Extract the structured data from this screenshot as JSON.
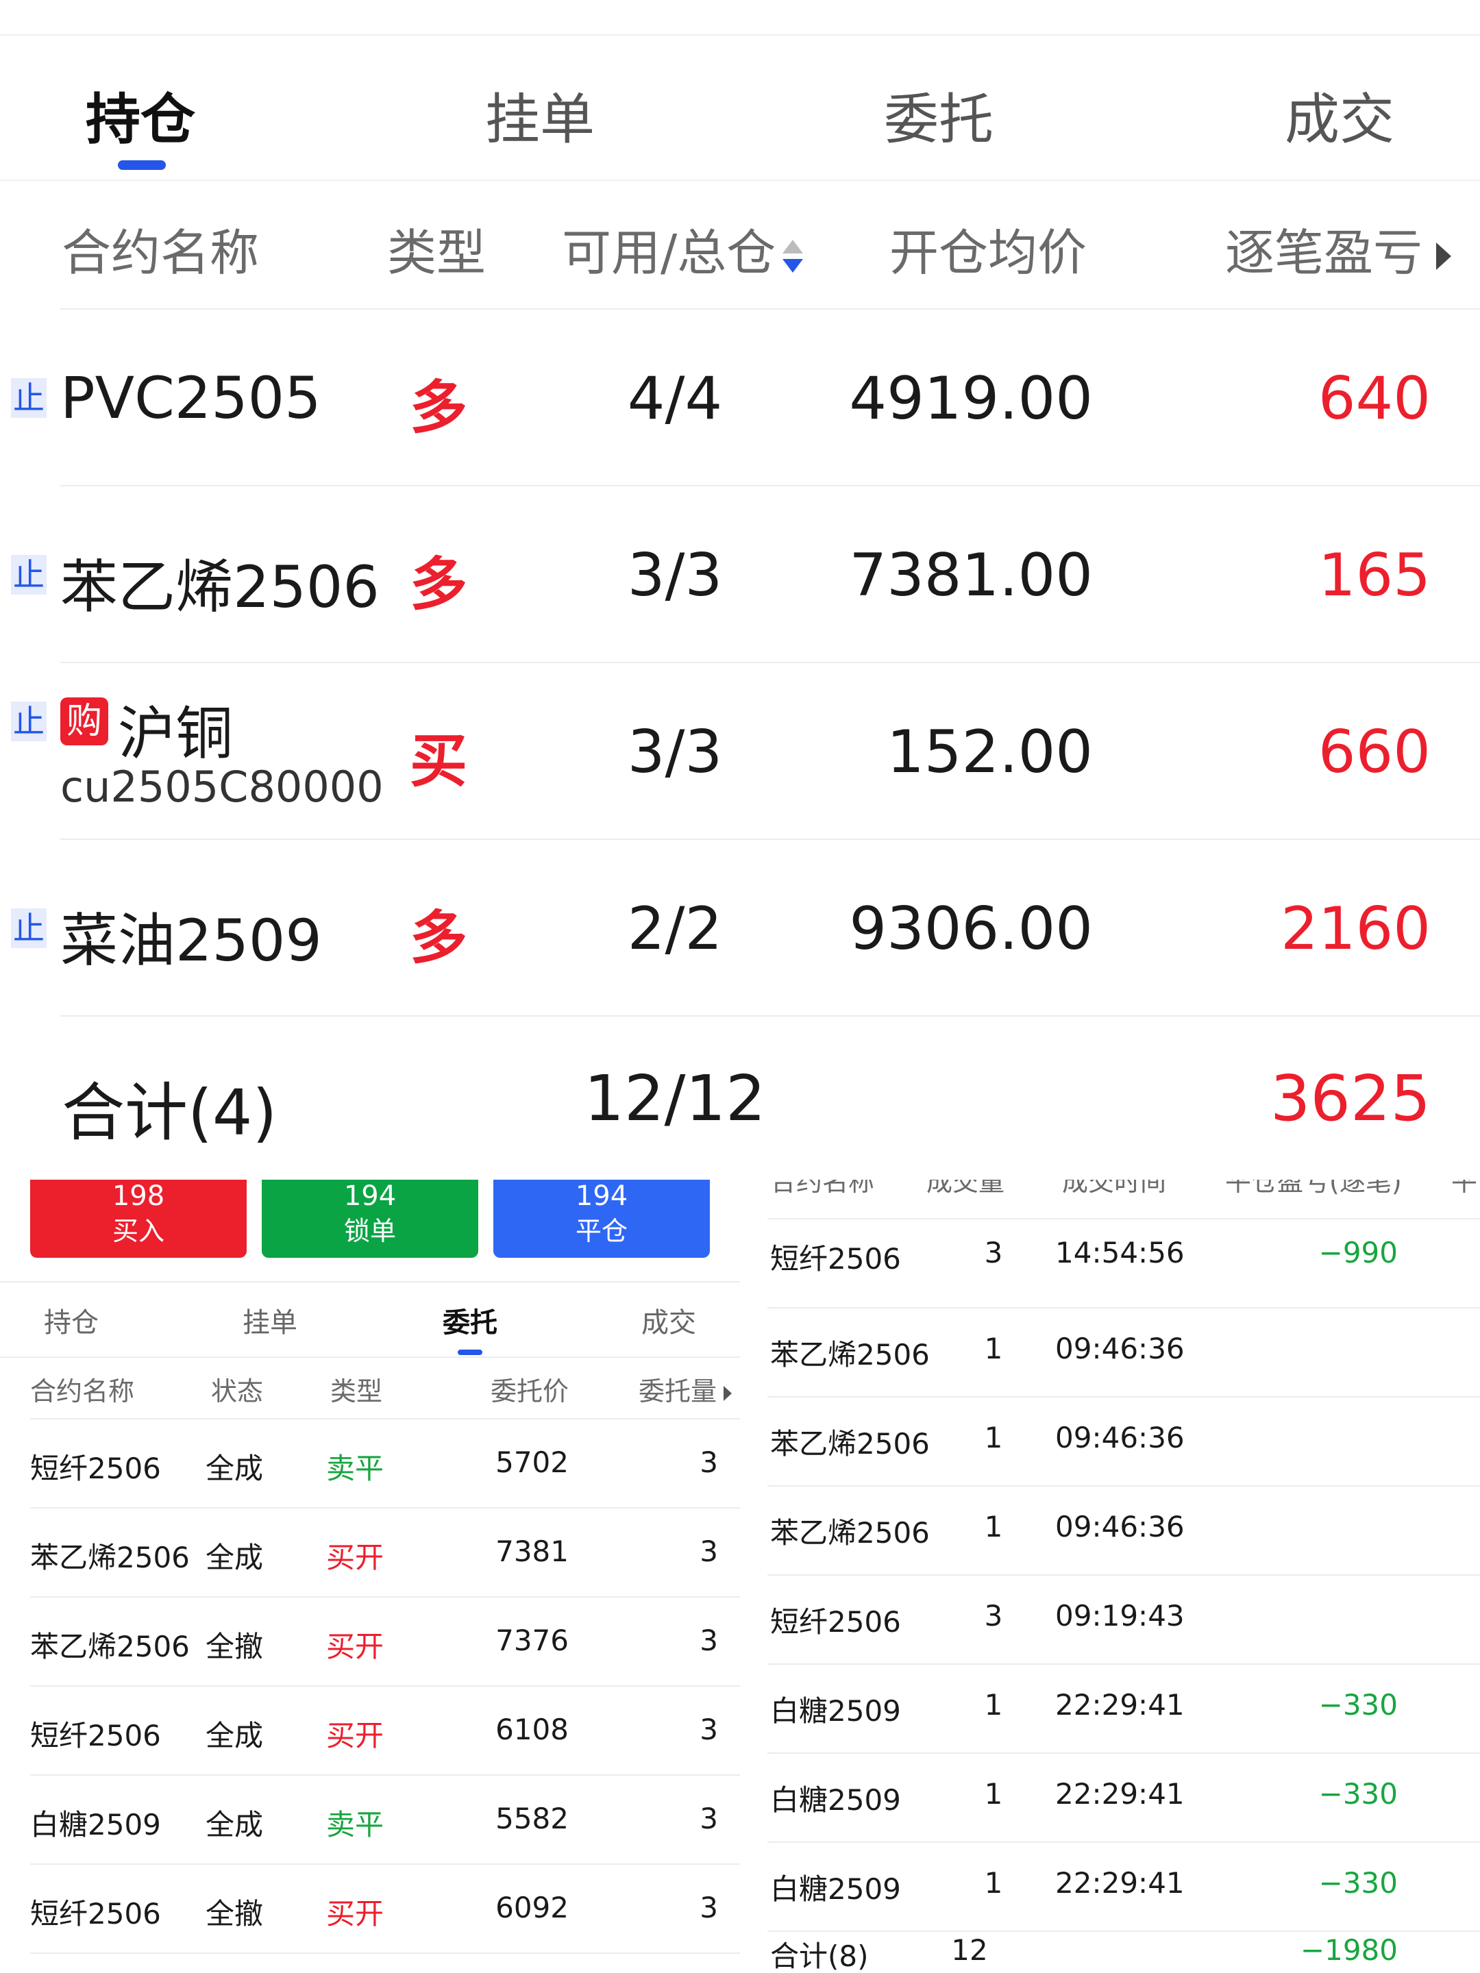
{
  "colors": {
    "red": "#ec1f2d",
    "green": "#18a63f",
    "blue": "#2456e8"
  },
  "top": {
    "tabs": [
      "持仓",
      "挂单",
      "委托",
      "成交"
    ],
    "active_tab": "持仓",
    "headers": {
      "name": "合约名称",
      "type": "类型",
      "qty": "可用/总仓",
      "price": "开仓均价",
      "pnl": "逐笔盈亏"
    },
    "stop_badge": "止",
    "buy_badge": "购",
    "rows": [
      {
        "name": "PVC2505",
        "sub": "",
        "type": "多",
        "qty": "4/4",
        "price": "4919.00",
        "pnl": "640"
      },
      {
        "name": "苯乙烯2506",
        "sub": "",
        "type": "多",
        "qty": "3/3",
        "price": "7381.00",
        "pnl": "165"
      },
      {
        "name": "沪铜",
        "sub": "cu2505C80000",
        "type": "买",
        "qty": "3/3",
        "price": "152.00",
        "pnl": "660"
      },
      {
        "name": "菜油2509",
        "sub": "",
        "type": "多",
        "qty": "2/2",
        "price": "9306.00",
        "pnl": "2160"
      }
    ],
    "total": {
      "label": "合计(4)",
      "qty": "12/12",
      "pnl": "3625"
    }
  },
  "orders": {
    "buttons": [
      {
        "num": "198",
        "label": "买入",
        "color": "#ec1f2d"
      },
      {
        "num": "194",
        "label": "锁单",
        "color": "#0aa444"
      },
      {
        "num": "194",
        "label": "平仓",
        "color": "#2f67f5"
      }
    ],
    "tabs": [
      "持仓",
      "挂单",
      "委托",
      "成交"
    ],
    "active_tab": "委托",
    "headers": {
      "name": "合约名称",
      "status": "状态",
      "type": "类型",
      "price": "委托价",
      "vol": "委托量"
    },
    "rows": [
      {
        "name": "短纤2506",
        "status": "全成",
        "type": "卖平",
        "price": "5702",
        "vol": "3"
      },
      {
        "name": "苯乙烯2506",
        "status": "全成",
        "type": "买开",
        "price": "7381",
        "vol": "3"
      },
      {
        "name": "苯乙烯2506",
        "status": "全撤",
        "type": "买开",
        "price": "7376",
        "vol": "3"
      },
      {
        "name": "短纤2506",
        "status": "全成",
        "type": "买开",
        "price": "6108",
        "vol": "3"
      },
      {
        "name": "白糖2509",
        "status": "全成",
        "type": "卖平",
        "price": "5582",
        "vol": "3"
      },
      {
        "name": "短纤2506",
        "status": "全撤",
        "type": "买开",
        "price": "6092",
        "vol": "3"
      }
    ]
  },
  "trades": {
    "headers": {
      "name": "合约名称",
      "qty": "成交量",
      "time": "成交时间",
      "pnl": "平仓盈亏(逐笔)",
      "extra": "平"
    },
    "rows": [
      {
        "name": "短纤2506",
        "qty": "3",
        "time": "14:54:56",
        "pnl": "-990"
      },
      {
        "name": "苯乙烯2506",
        "qty": "1",
        "time": "09:46:36",
        "pnl": ""
      },
      {
        "name": "苯乙烯2506",
        "qty": "1",
        "time": "09:46:36",
        "pnl": ""
      },
      {
        "name": "苯乙烯2506",
        "qty": "1",
        "time": "09:46:36",
        "pnl": ""
      },
      {
        "name": "短纤2506",
        "qty": "3",
        "time": "09:19:43",
        "pnl": ""
      },
      {
        "name": "白糖2509",
        "qty": "1",
        "time": "22:29:41",
        "pnl": "-330"
      },
      {
        "name": "白糖2509",
        "qty": "1",
        "time": "22:29:41",
        "pnl": "-330"
      },
      {
        "name": "白糖2509",
        "qty": "1",
        "time": "22:29:41",
        "pnl": "-330"
      }
    ],
    "total": {
      "label": "合计(8)",
      "qty": "12",
      "pnl": "-1980"
    }
  }
}
